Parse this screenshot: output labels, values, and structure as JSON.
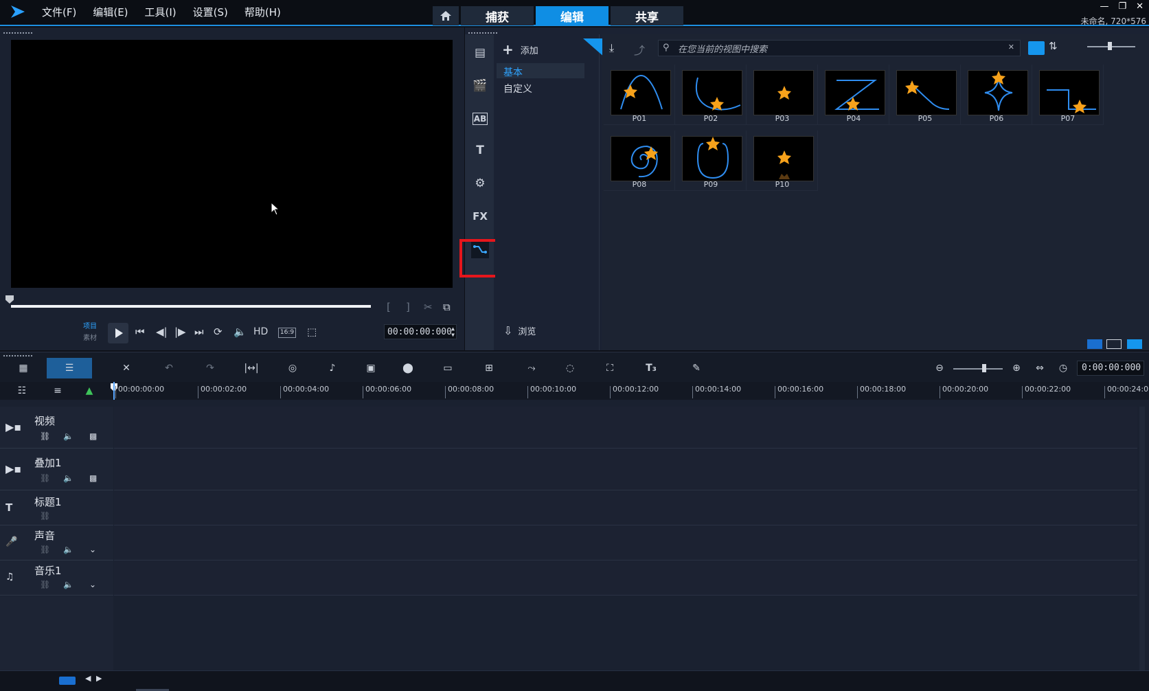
{
  "menu": [
    "文件(F)",
    "编辑(E)",
    "工具(I)",
    "设置(S)",
    "帮助(H)"
  ],
  "tabs": {
    "capture": "捕获",
    "edit": "编辑",
    "share": "共享"
  },
  "project_info": "未命名, 720*576",
  "player": {
    "mode_project": "项目",
    "mode_clip": "素材",
    "hd_label": "HD",
    "aspect_label": "16:9",
    "timecode": "00:00:00:000"
  },
  "library": {
    "add_label": "添加",
    "folders": [
      "基本",
      "自定义"
    ],
    "search_placeholder": "在您当前的视图中搜索",
    "browse_label": "浏览",
    "items": [
      "P01",
      "P02",
      "P03",
      "P04",
      "P05",
      "P06",
      "P07",
      "P08",
      "P09",
      "P10"
    ],
    "fx_label": "FX"
  },
  "timeline": {
    "timecode": "0:00:00:000",
    "ruler": [
      "00:00:00:00",
      "00:00:02:00",
      "00:00:04:00",
      "00:00:06:00",
      "00:00:08:00",
      "00:00:10:00",
      "00:00:12:00",
      "00:00:14:00",
      "00:00:16:00",
      "00:00:18:00",
      "00:00:20:00",
      "00:00:22:00",
      "00:00:24:0"
    ],
    "tracks": [
      {
        "name": "视频"
      },
      {
        "name": "叠加1"
      },
      {
        "name": "标题1"
      },
      {
        "name": "声音"
      },
      {
        "name": "音乐1"
      }
    ]
  },
  "colors": {
    "accent": "#0f8ee4",
    "highlight": "#e6161c",
    "star": "#f7a21b",
    "path": "#2f8df0"
  }
}
